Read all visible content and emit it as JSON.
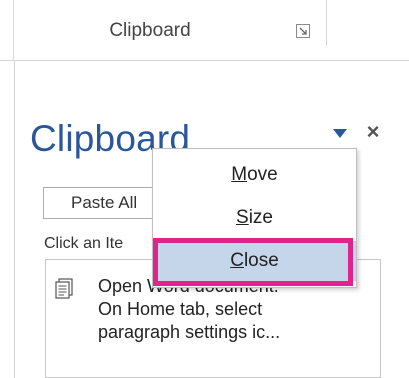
{
  "ribbon": {
    "group_title": "Clipboard",
    "launcher_icon": "dialog-launcher-icon"
  },
  "pane": {
    "title": "Clipboard",
    "options_icon": "triangle-down-icon",
    "close_label": "×",
    "paste_all_label": "Paste All",
    "click_item_label": "Click an Ite",
    "item": {
      "icon": "document-icon",
      "lines": [
        "Open Word document.",
        "On Home tab, select",
        "paragraph settings ic..."
      ]
    }
  },
  "menu": {
    "items": [
      {
        "mnemonic": "M",
        "rest": "ove"
      },
      {
        "mnemonic": "S",
        "rest": "ize"
      },
      {
        "mnemonic": "C",
        "rest": "lose"
      }
    ],
    "highlighted_index": 2,
    "highlight_color": "#e0248b",
    "selected_bg": "#c5d5ea"
  },
  "colors": {
    "title_blue": "#2b579a"
  }
}
